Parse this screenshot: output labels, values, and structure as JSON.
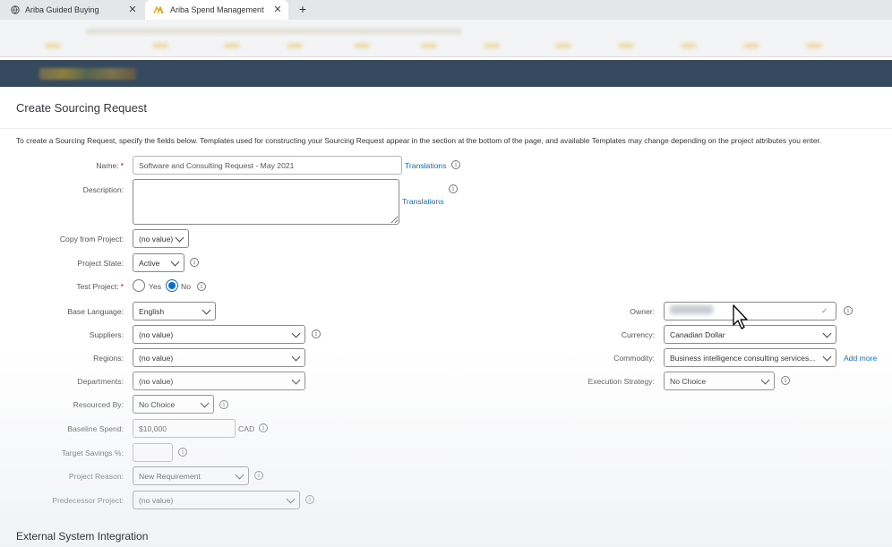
{
  "browser": {
    "tabs": [
      {
        "title": "Ariba Guided Buying",
        "active": false
      },
      {
        "title": "Ariba Spend Management",
        "active": true
      }
    ],
    "close_glyph": "✕",
    "new_tab_glyph": "+"
  },
  "page": {
    "title": "Create Sourcing Request",
    "intro": "To create a Sourcing Request, specify the fields below. Templates used for constructing your Sourcing Request appear in the section at the bottom of the page, and available Templates may change depending on the project attributes you enter.",
    "section_title": "External System Integration"
  },
  "form": {
    "name": {
      "label": "Name:",
      "required_mark": "*",
      "value": "Software and Consulting Request - May 2021",
      "link": "Translations"
    },
    "description": {
      "label": "Description:",
      "value": "",
      "link": "Translations"
    },
    "copy_from_project": {
      "label": "Copy from Project:",
      "value": "(no value)"
    },
    "project_state": {
      "label": "Project State:",
      "value": "Active"
    },
    "test_project": {
      "label": "Test Project:",
      "required_mark": "*",
      "options": [
        "Yes",
        "No"
      ],
      "selected": "No"
    },
    "base_language": {
      "label": "Base Language:",
      "value": "English"
    },
    "suppliers": {
      "label": "Suppliers:",
      "value": "(no value)"
    },
    "regions": {
      "label": "Regions:",
      "value": "(no value)"
    },
    "departments": {
      "label": "Departments:",
      "value": "(no value)"
    },
    "resourced_by": {
      "label": "Resourced By:",
      "value": "No Choice"
    },
    "baseline_spend": {
      "label": "Baseline Spend:",
      "value": "$10,000",
      "currency": "CAD"
    },
    "target_savings": {
      "label": "Target Savings %:",
      "value": ""
    },
    "project_reason": {
      "label": "Project Reason:",
      "value": "New Requirement"
    },
    "predecessor_project": {
      "label": "Predecessor Project:",
      "value": "(no value)"
    },
    "owner": {
      "label": "Owner:",
      "check_glyph": "✓"
    },
    "currency": {
      "label": "Currency:",
      "value": "Canadian Dollar"
    },
    "commodity": {
      "label": "Commodity:",
      "value": "Business intelligence consulting services...",
      "link": "Add more"
    },
    "execution_strategy": {
      "label": "Execution Strategy:",
      "value": "No Choice"
    }
  },
  "icons": {
    "info": "i",
    "info_name": "info-icon"
  },
  "colors": {
    "header": "#354a5f",
    "link": "#0a6ed1",
    "required": "#bb0000"
  }
}
